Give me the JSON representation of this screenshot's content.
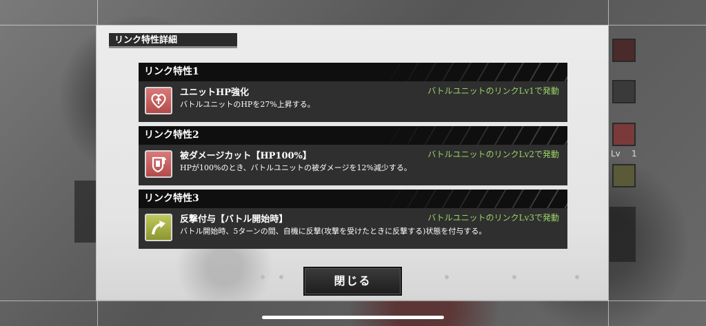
{
  "modal": {
    "title": "リンク特性詳細",
    "close_label": "閉じる"
  },
  "traits": [
    {
      "header": "リンク特性1",
      "name": "ユニットHP強化",
      "condition": "バトルユニットのリンクLv1で発動",
      "description": "バトルユニットのHPを27%上昇する。",
      "icon": "heart-up-icon",
      "icon_color": "#c45a5a"
    },
    {
      "header": "リンク特性2",
      "name": "被ダメージカット【HP100%】",
      "condition": "バトルユニットのリンクLv2で発動",
      "description": "HPが100%のとき、バトルユニットの被ダメージを12%減少する。",
      "icon": "shield-up-icon",
      "icon_color": "#c45a5a"
    },
    {
      "header": "リンク特性3",
      "name": "反撃付与【バトル開始時】",
      "condition": "バトルユニットのリンクLv3で発動",
      "description": "バトル開始時、5ターンの間、自機に反撃(攻撃を受けたときに反撃する)状態を付与する。",
      "icon": "counter-arrow-icon",
      "icon_color": "#a8b040"
    }
  ],
  "background": {
    "lv_label": "Lv",
    "lv_value": "1"
  }
}
